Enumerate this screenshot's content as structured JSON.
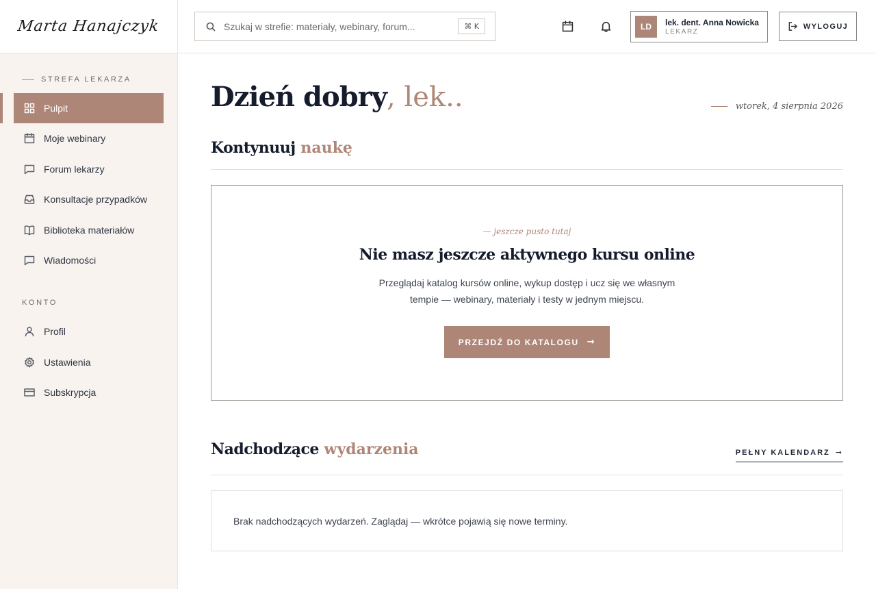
{
  "brand": {
    "logo_text": "Marta Hanajczyk"
  },
  "search": {
    "placeholder": "Szukaj w strefie: materiały, webinary, forum...",
    "shortcut": "⌘ K"
  },
  "user": {
    "initials": "LD",
    "name": "lek. dent. Anna Nowicka",
    "role": "LEKARZ"
  },
  "topbar": {
    "logout_label": "WYLOGUJ"
  },
  "sidebar": {
    "section_main": "STREFA LEKARZA",
    "section_account": "KONTO",
    "items": [
      {
        "label": "Pulpit",
        "icon": "dashboard-icon",
        "active": true
      },
      {
        "label": "Moje webinary",
        "icon": "calendar-icon"
      },
      {
        "label": "Forum lekarzy",
        "icon": "chat-icon"
      },
      {
        "label": "Konsultacje przypadków",
        "icon": "inbox-icon"
      },
      {
        "label": "Biblioteka materiałów",
        "icon": "book-icon"
      },
      {
        "label": "Wiadomości",
        "icon": "message-icon"
      }
    ],
    "account_items": [
      {
        "label": "Profil",
        "icon": "user-icon"
      },
      {
        "label": "Ustawienia",
        "icon": "gear-icon"
      },
      {
        "label": "Subskrypcja",
        "icon": "credit-card-icon"
      }
    ]
  },
  "main": {
    "greeting_bold": "Dzień dobry",
    "greeting_light": ", lek..",
    "date": "wtorek, 4 sierpnia 2026",
    "learning": {
      "title_bold": "Kontynuuj",
      "title_light": "naukę",
      "eyebrow": "— jeszcze pusto tutaj",
      "heading": "Nie masz jeszcze aktywnego kursu online",
      "text": "Przeglądaj katalog kursów online, wykup dostęp i ucz się we własnym tempie — webinary, materiały i testy w jednym miejscu.",
      "cta_label": "PRZEJDŹ DO KATALOGU",
      "cta_arrow": "→"
    },
    "events": {
      "title_bold": "Nadchodzące",
      "title_light": "wydarzenia",
      "link_label": "PEŁNY KALENDARZ",
      "link_arrow": "➞",
      "empty_text": "Brak nadchodzących wydarzeń. Zaglądaj — wkrótce pojawią się nowe terminy."
    }
  },
  "colors": {
    "accent": "#ad8677",
    "sidebar_bg": "#f8f3ef",
    "heading": "#151c2c"
  }
}
